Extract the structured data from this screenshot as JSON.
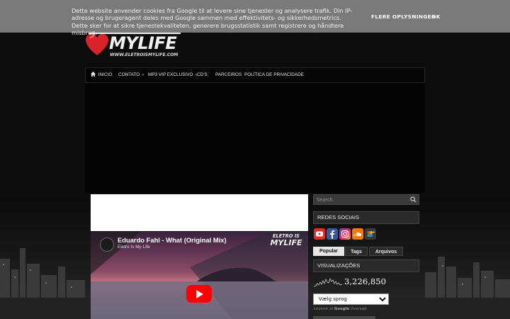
{
  "cookie_bar": {
    "text": "Dette website anvender cookies fra Google til at levere sine tjenester og analysere trafik. Din IP-adresse og brugeragent deles med Google sammen med effektivitets- og sikkerhedsmetrics. Dette sker for at sikre tjenestekvaliteten, generere brugsstatistik samt registrere og håndtere misbrug.",
    "more_label": "FLERE OPLYSNINGER",
    "ok_label": "OK"
  },
  "logo": {
    "name": "MYLIFE",
    "url": "WWW.ELETROISMYLIFE.COM"
  },
  "nav": {
    "items": [
      {
        "label": "INICIO",
        "icon": "home-icon",
        "has_submenu": false
      },
      {
        "label": "CONTATO",
        "has_submenu": true
      },
      {
        "label": "MP3 VIP EXCLUSIVO",
        "has_submenu": true
      },
      {
        "label": "CD'S",
        "has_submenu": false
      },
      {
        "label": "PARCEIROS",
        "has_submenu": false
      },
      {
        "label": "POLÍTICA DE PRIVACIDADE",
        "has_submenu": false
      }
    ],
    "submenu_arrow": "»"
  },
  "video": {
    "title": "Eduardo Fahl - What (Original Mix)",
    "channel": "Eletro Is My Life",
    "overlay_logo_line1": "ELETRO IS",
    "overlay_logo_line2": "MYLIFE"
  },
  "sidebar": {
    "search_placeholder": "Search",
    "redes_sociais_title": "REDES SOCIAIS",
    "social_icons": [
      {
        "name": "youtube-icon",
        "color": "#e52d27"
      },
      {
        "name": "facebook-icon",
        "color": "#3b5998"
      },
      {
        "name": "instagram-icon",
        "color": "#c13584"
      },
      {
        "name": "soundcloud-icon",
        "color": "#ff7700"
      },
      {
        "name": "google-plus-icon",
        "color": "#3a3a3a"
      }
    ],
    "tabs": [
      {
        "label": "Popular",
        "active": true
      },
      {
        "label": "Tags",
        "active": false
      },
      {
        "label": "Arquivos",
        "active": false
      }
    ],
    "visualizacoes_title": "VISUALIZAÇÕES",
    "visualizacoes_count": "3,226,850",
    "language_select": "Vælg sprog",
    "powered_by": "Leveret af",
    "powered_google": "Google",
    "powered_translate": "Oversæt"
  }
}
